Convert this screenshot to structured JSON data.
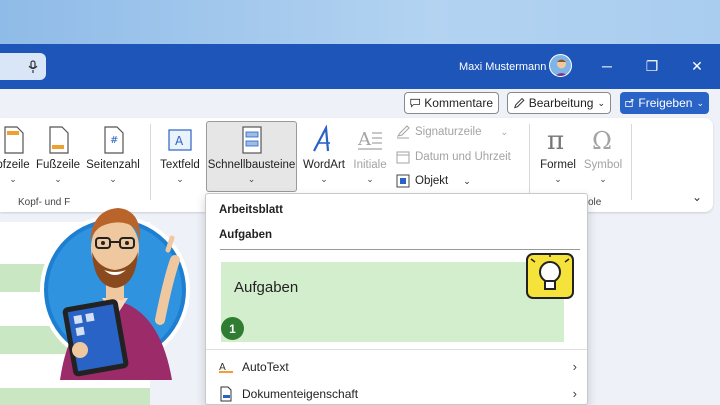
{
  "titlebar": {
    "user_name": "Maxi Mustermann",
    "minimize_glyph": "─",
    "restore_glyph": "❐",
    "close_glyph": "✕"
  },
  "actions": {
    "comments_label": "Kommentare",
    "editing_label": "Bearbeitung",
    "share_label": "Freigeben"
  },
  "ribbon": {
    "items": [
      {
        "label": "Kopfzeile",
        "shown": "pfzeile"
      },
      {
        "label": "Fußzeile"
      },
      {
        "label": "Seitenzahl"
      },
      {
        "label": "Textfeld"
      },
      {
        "label": "Schnellbausteine"
      },
      {
        "label": "WordArt"
      },
      {
        "label": "Initiale"
      },
      {
        "label": "Formel"
      },
      {
        "label": "Symbol"
      }
    ],
    "small_items": [
      {
        "label": "Signaturzeile"
      },
      {
        "label": "Datum und Uhrzeit"
      },
      {
        "label": "Objekt"
      }
    ],
    "group_labels": [
      "Kopf- und F",
      "ole"
    ]
  },
  "dropdown": {
    "section_heading": "Arbeitsblatt",
    "subheading": "Aufgaben",
    "preview_title": "Aufgaben",
    "preview_number": "1",
    "menu_items": [
      {
        "label": "AutoText"
      },
      {
        "label": "Dokumenteigenschaft"
      }
    ]
  },
  "colors": {
    "titlebar": "#1d55b8",
    "share_button": "#2a63c6",
    "preview_green": "#d3eecd",
    "number_badge": "#2e7d32",
    "lightbulb_badge": "#f5e23a"
  },
  "icons": [
    "microphone-icon",
    "comment-icon",
    "pen-icon",
    "share-icon",
    "lightbulb-icon",
    "autotext-icon",
    "document-property-icon"
  ]
}
